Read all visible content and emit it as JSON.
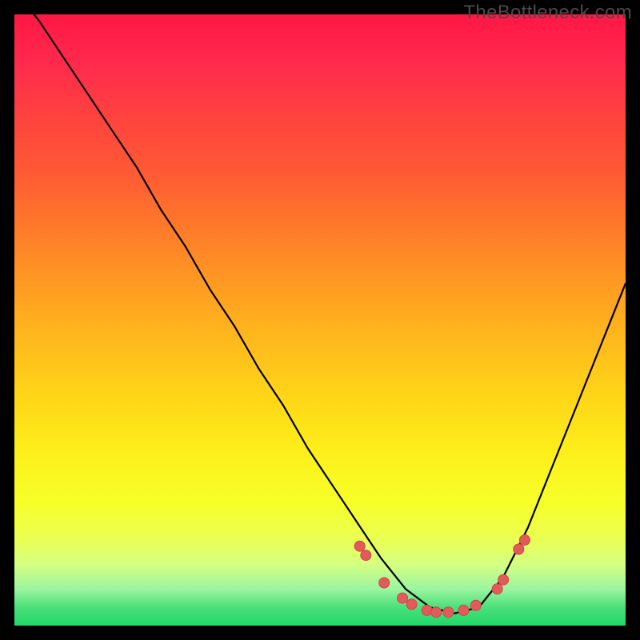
{
  "watermark": "TheBottleneck.com",
  "colors": {
    "frame": "#000000",
    "curve_stroke": "#000000",
    "marker_fill": "#e45a5a",
    "marker_stroke": "#c94848"
  },
  "chart_data": {
    "type": "line",
    "title": "",
    "xlabel": "",
    "ylabel": "",
    "xlim": [
      0,
      100
    ],
    "ylim": [
      0,
      100
    ],
    "series": [
      {
        "name": "bottleneck-curve",
        "x": [
          0,
          4,
          8,
          12,
          16,
          20,
          24,
          28,
          32,
          36,
          40,
          44,
          48,
          52,
          56,
          60,
          64,
          68,
          72,
          76,
          80,
          84,
          88,
          92,
          96,
          100
        ],
        "y": [
          104,
          99,
          93,
          87,
          81,
          75,
          68,
          62,
          55,
          49,
          42,
          36,
          29,
          23,
          17,
          11,
          6,
          3,
          2,
          3,
          8,
          16,
          26,
          36,
          46,
          56
        ]
      }
    ],
    "markers": {
      "name": "highlighted-points",
      "x": [
        56.5,
        57.5,
        60.5,
        63.5,
        65.0,
        67.5,
        69.0,
        71.0,
        73.5,
        75.5,
        79.0,
        80.0,
        82.5,
        83.5
      ],
      "y": [
        13.0,
        11.5,
        7.0,
        4.5,
        3.5,
        2.5,
        2.2,
        2.2,
        2.5,
        3.3,
        6.0,
        7.5,
        12.5,
        14.0
      ]
    }
  }
}
